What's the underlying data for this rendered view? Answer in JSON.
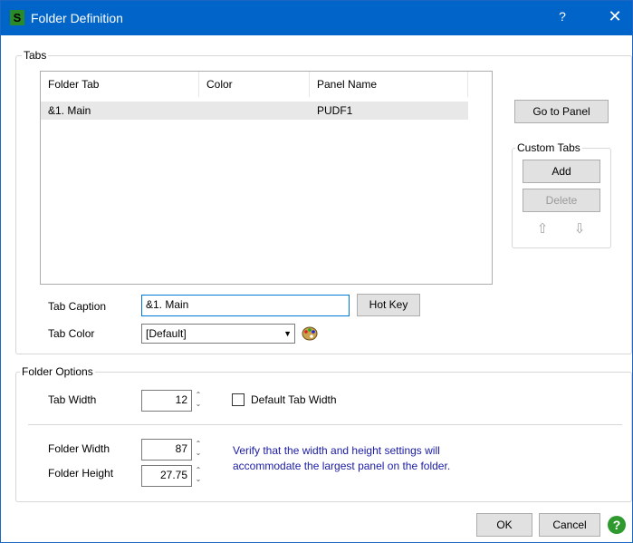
{
  "window": {
    "title": "Folder Definition",
    "help_glyph": "?",
    "close_glyph": "✕",
    "app_glyph": "S"
  },
  "tabs_group": {
    "title": "Tabs",
    "columns": [
      "Folder Tab",
      "Color",
      "Panel Name"
    ],
    "rows": [
      {
        "folder_tab": "&1. Main",
        "color": "",
        "panel_name": "PUDF1"
      }
    ],
    "tab_caption_label": "Tab Caption",
    "tab_caption_value": "&1. Main",
    "hot_key_button": "Hot Key",
    "tab_color_label": "Tab Color",
    "tab_color_value": "[Default]",
    "go_to_panel_button": "Go to Panel"
  },
  "custom_tabs": {
    "title": "Custom Tabs",
    "add_button": "Add",
    "delete_button": "Delete"
  },
  "folder_options": {
    "title": "Folder Options",
    "tab_width_label": "Tab Width",
    "tab_width_value": "12",
    "default_tab_width_label": "Default Tab Width",
    "default_tab_width_checked": false,
    "folder_width_label": "Folder Width",
    "folder_width_value": "87",
    "folder_height_label": "Folder Height",
    "folder_height_value": "27.75",
    "info_text_line1": "Verify that the width and height settings will",
    "info_text_line2": "accommodate the largest panel on the folder."
  },
  "footer": {
    "ok_button": "OK",
    "cancel_button": "Cancel",
    "help_glyph": "?"
  },
  "colors": {
    "titlebar": "#0064c8",
    "info_text": "#1a1aa6",
    "help_green": "#2e9a2e"
  }
}
